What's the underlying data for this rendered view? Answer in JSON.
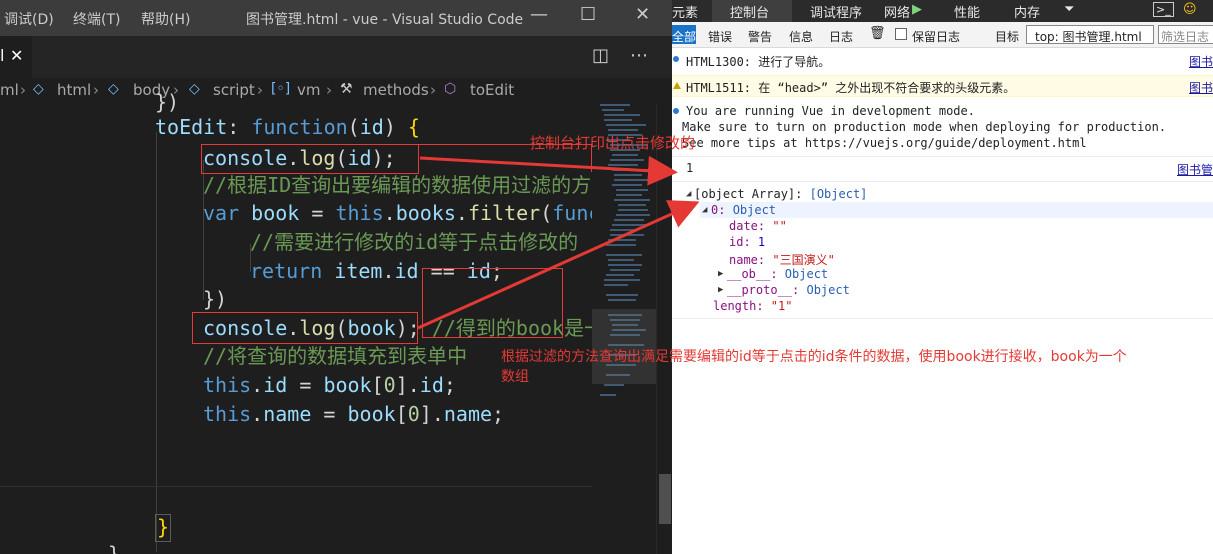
{
  "vscode": {
    "menu": [
      "调试(D)",
      "终端(T)",
      "帮助(H)"
    ],
    "window_title": "图书管理.html - vue - Visual Studio Code",
    "window_controls": {
      "minimize": "—",
      "maximize": "☐",
      "close": "✕"
    },
    "tab": {
      "label": "l",
      "close": "✕"
    },
    "editor_actions": {
      "split": "◫",
      "more": "⋯"
    },
    "breadcrumb": [
      "ml",
      "html",
      "body",
      "script",
      "vm",
      "methods",
      "toEdit"
    ],
    "code": {
      "l0": "})",
      "l1a": "toEdit",
      "l1b": ": ",
      "l1c": "function",
      "l1d": "(",
      "l1e": "id",
      "l1f": ") ",
      "l1g": "{",
      "l2a": "console",
      "l2b": ".",
      "l2c": "log",
      "l2d": "(",
      "l2e": "id",
      "l2f": ");",
      "l3": "//根据ID查询出要编辑的数据使用过滤的方",
      "l4a": "var",
      "l4b": " ",
      "l4c": "book",
      "l4d": " = ",
      "l4e": "this",
      "l4f": ".",
      "l4g": "books",
      "l4h": ".",
      "l4i": "filter",
      "l4j": "(",
      "l4k": "func",
      "l5": "//需要进行修改的id等于点击修改的",
      "l6a": "return",
      "l6b": " ",
      "l6c": "item",
      "l6d": ".",
      "l6e": "id",
      "l6f": " == ",
      "l6g": "id",
      "l6h": ";",
      "l7": "})",
      "l8a": "console",
      "l8b": ".",
      "l8c": "log",
      "l8d": "(",
      "l8e": "book",
      "l8f": ");",
      "l8g": " //得到的book是一",
      "l9": "//将查询的数据填充到表单中",
      "l10a": "this",
      "l10b": ".",
      "l10c": "id",
      "l10d": " = ",
      "l10e": "book",
      "l10f": "[",
      "l10g": "0",
      "l10h": "].",
      "l10i": "id",
      "l10j": ";",
      "l11a": "this",
      "l11b": ".",
      "l11c": "name",
      "l11d": " = ",
      "l11e": "book",
      "l11f": "[",
      "l11g": "0",
      "l11h": "].",
      "l11i": "name",
      "l11j": ";",
      "l12": "}",
      "l13": "},"
    }
  },
  "devtools": {
    "tabs": [
      "元素",
      "控制台",
      "调试程序",
      "网络",
      "性能",
      "内存"
    ],
    "toolbar": {
      "all": "全部",
      "errors": "错误",
      "warnings": "警告",
      "info": "信息",
      "log": "日志",
      "preserve_log": "保留日志",
      "target_label": "目标",
      "target_value": "_top: 图书管理.html",
      "filter_placeholder": "筛选日志"
    },
    "messages": {
      "m1_text": "HTML1300: 进行了导航。",
      "m1_src": "图书",
      "m2_text": "HTML1511: 在 “head>” 之外出现不符合要求的头级元素。",
      "m2_src": "图书",
      "m3_l1": "You are running Vue in development mode.",
      "m3_l2": "Make sure to turn on production mode when deploying for production.",
      "m3_l3": "See more tips at https://vuejs.org/guide/deployment.html",
      "m4_value": "1",
      "m4_src": "图书管",
      "m5_head": "[object Array]: ",
      "m5_head_obj": "[Object]",
      "m5_0_key": "0: ",
      "m5_0_val": "Object",
      "m5_date_key": "date: ",
      "m5_date_val": "\"\"",
      "m5_id_key": "id: ",
      "m5_id_val": "1",
      "m5_name_key": "name: ",
      "m5_name_val": "\"三国演义\"",
      "m5_ob_key": "__ob__: ",
      "m5_ob_val": "Object",
      "m5_proto_key": "__proto__: ",
      "m5_proto_val": "Object",
      "m5_len_key": "length: ",
      "m5_len_val": "\"1\""
    }
  },
  "annotations": {
    "note1": "控制台打印出点击修改的",
    "note2a": "根据过滤的方法查询出满足需要编辑的id等于点击的id条件的数据，使用book进行接收，book为一个",
    "note2b": "数组",
    "color": "#e53935"
  }
}
